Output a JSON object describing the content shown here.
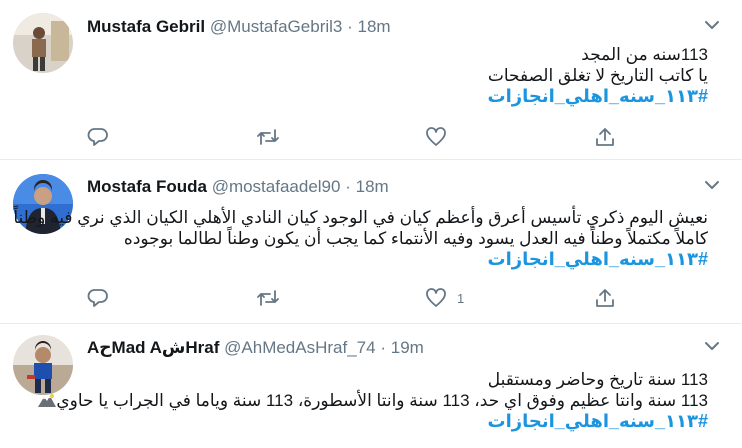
{
  "tweets": [
    {
      "name": "Mustafa Gebril",
      "handle": "@MustafaGebril3",
      "separator": "·",
      "time": "18m",
      "lines": [
        "113سنه من المجد",
        "يا كاتب التاريخ لا تغلق الصفحات"
      ],
      "hashtag": "#١١٣_سنه_اهلي_انجازات",
      "like_count": ""
    },
    {
      "name": "Mostafa Fouda",
      "handle": "@mostafaadel90",
      "separator": "·",
      "time": "18m",
      "lines": [
        "نعيش اليوم ذكري تأسيس أعرق وأعظم كيان في الوجود كيان النادي الأهلي الكيان الذي نري فيه وطناً",
        "كاملاً مكتملاً وطناً فيه العدل يسود وفيه الأنتماء كما يجب أن يكون وطناً لطالما بوجوده"
      ],
      "hashtag": "#١١٣_سنه_اهلي_انجازات",
      "like_count": "1"
    },
    {
      "name": "AحMad AشHraf",
      "handle": "@AhMedAsHraf_74",
      "separator": "·",
      "time": "19m",
      "lines": [
        "113 سنة تاريخ وحاضر ومستقبل",
        "113 سنة وانتا عظيم وفوق اي حد، 113 سنة وانتا الأسطورة، 113 سنة وياما في الجراب يا حاوي"
      ],
      "hashtag": "#١١٣_سنه_اهلي_انجازات",
      "like_count": ""
    }
  ],
  "colors": {
    "link": "#1b95e0",
    "secondary": "#657786",
    "text": "#14171a",
    "border": "#e6ecf0"
  },
  "icons": {
    "reply": "reply-icon",
    "retweet": "retweet-icon",
    "like": "heart-icon",
    "share": "share-icon",
    "menu": "chevron-down-icon"
  }
}
